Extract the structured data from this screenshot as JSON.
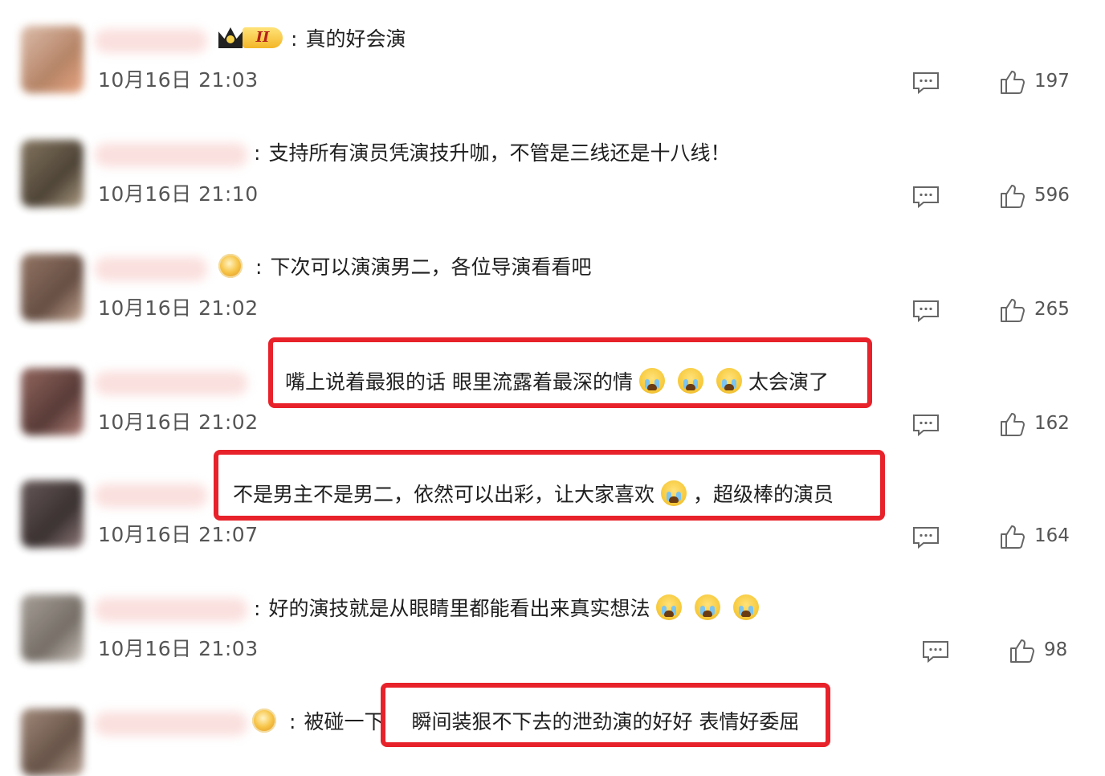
{
  "comments": [
    {
      "text_parts": [
        "真的好会演"
      ],
      "timestamp": "10月16日 21:03",
      "likes": "197",
      "badge": "vip-crown-II",
      "badge_label": "II",
      "highlighted": false
    },
    {
      "text_parts": [
        "支持所有演员凭演技升咖，不管是三线还是十八线！"
      ],
      "timestamp": "10月16日 21:10",
      "likes": "596",
      "badge": "none",
      "highlighted": false
    },
    {
      "text_parts": [
        "下次可以演演男二，各位导演看看吧"
      ],
      "timestamp": "10月16日 21:02",
      "likes": "265",
      "badge": "fan-medal-icon",
      "highlighted": false
    },
    {
      "text_parts": [
        "嘴上说着最狠的话 眼里流露着最深的情",
        "太会演了"
      ],
      "emoji_count": 3,
      "emoji": "crying-face-icon",
      "timestamp": "10月16日 21:02",
      "likes": "162",
      "badge": "none",
      "highlighted": true
    },
    {
      "text_parts": [
        "不是男主不是男二，依然可以出彩，让大家喜欢",
        "，超级棒的演员"
      ],
      "emoji_count": 1,
      "emoji": "crying-face-icon",
      "timestamp": "10月16日 21:07",
      "likes": "164",
      "badge": "none",
      "highlighted": true
    },
    {
      "text_parts": [
        "好的演技就是从眼睛里都能看出来真实想法"
      ],
      "emoji_count": 3,
      "emoji": "loudly-crying-face-icon",
      "timestamp": "10月16日 21:03",
      "likes": "98",
      "badge": "none",
      "highlighted": false
    },
    {
      "text_parts": [
        "被碰一下",
        "瞬间装狠不下去的泄劲演的好好 表情好委屈"
      ],
      "badge": "fan-medal-icon",
      "highlighted": true
    }
  ],
  "colors": {
    "highlight_border": "#e8222a",
    "text": "#1f1f1f",
    "meta_text": "#555555"
  }
}
